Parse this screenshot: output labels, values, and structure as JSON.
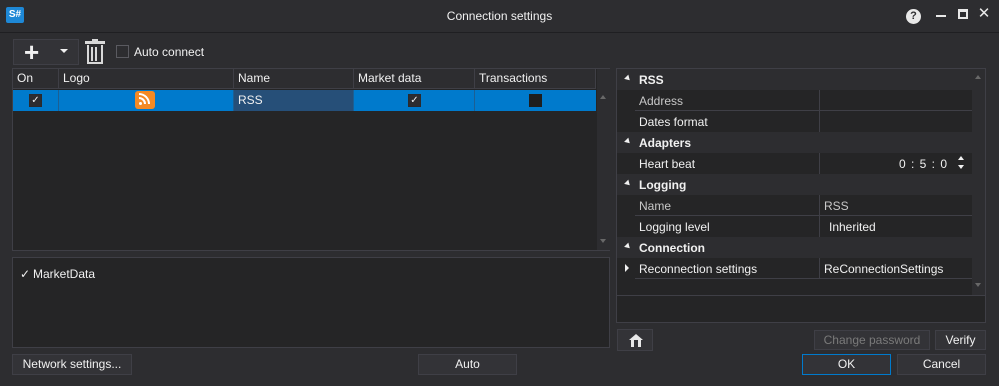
{
  "window": {
    "app_badge": "S#",
    "title": "Connection settings",
    "help_glyph": "?",
    "close_glyph": "✕"
  },
  "toolbar": {
    "add_glyph": "+",
    "auto_connect_label": "Auto connect",
    "auto_connect_checked": false
  },
  "grid": {
    "columns": [
      "On",
      "Logo",
      "Name",
      "Market data",
      "Transactions"
    ],
    "rows": [
      {
        "on": true,
        "logo": "rss-icon",
        "name": "RSS",
        "market_data": true,
        "transactions": false
      }
    ],
    "check_glyph": "✓"
  },
  "messages": {
    "items": [
      {
        "label": "MarketData",
        "checked": true,
        "glyph": "✓"
      }
    ]
  },
  "properties": {
    "categories": [
      {
        "name": "RSS",
        "props": [
          {
            "name": "Address",
            "value": ""
          },
          {
            "name": "Dates format",
            "value": ""
          }
        ]
      },
      {
        "name": "Adapters",
        "props": [
          {
            "name": "Heart beat",
            "value": "0 : 5 : 0"
          }
        ]
      },
      {
        "name": "Logging",
        "props": [
          {
            "name": "Name",
            "value": "RSS"
          },
          {
            "name": "Logging level",
            "value": "Inherited"
          }
        ]
      },
      {
        "name": "Connection",
        "props": [
          {
            "name": "Reconnection settings",
            "value": "ReConnectionSettings"
          }
        ]
      }
    ]
  },
  "buttons": {
    "change_password": "Change password",
    "verify": "Verify",
    "network_settings": "Network settings...",
    "auto": "Auto",
    "ok": "OK",
    "cancel": "Cancel"
  },
  "colors": {
    "background": "#2d2d30",
    "selection": "#007acc",
    "rss_orange": "#f48a24"
  }
}
